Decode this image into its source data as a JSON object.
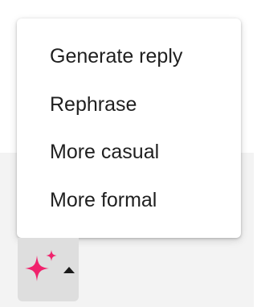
{
  "menu": {
    "items": [
      {
        "label": "Generate reply"
      },
      {
        "label": "Rephrase"
      },
      {
        "label": "More casual"
      },
      {
        "label": "More formal"
      }
    ]
  },
  "ai_button": {
    "icon": "sparkle-icon",
    "icon_color": "#f0226c",
    "caret_icon": "caret-up-icon"
  },
  "colors": {
    "menu_background": "#ffffff",
    "page_background_lower": "#f3f3f3",
    "button_background": "#dedede",
    "text": "#1f1f1f"
  }
}
